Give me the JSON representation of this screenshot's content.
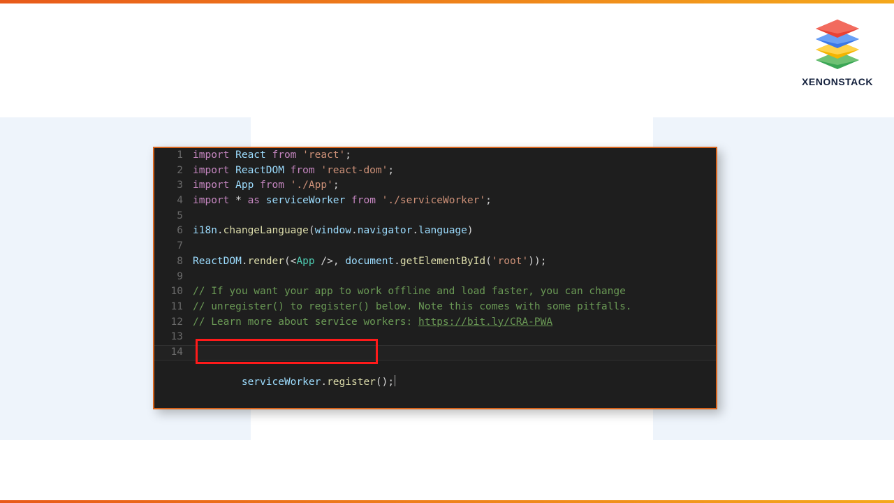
{
  "brand": {
    "name": "XENONSTACK"
  },
  "code": {
    "line_numbers": [
      "1",
      "2",
      "3",
      "4",
      "5",
      "6",
      "7",
      "8",
      "9",
      "10",
      "11",
      "12",
      "13",
      "14"
    ],
    "l1": {
      "import": "import ",
      "sym": "React",
      "from": " from ",
      "str": "'react'",
      "end": ";"
    },
    "l2": {
      "import": "import ",
      "sym": "ReactDOM",
      "from": " from ",
      "str": "'react-dom'",
      "end": ";"
    },
    "l3": {
      "import": "import ",
      "sym": "App",
      "from": " from ",
      "str": "'./App'",
      "end": ";"
    },
    "l4": {
      "import": "import ",
      "star": "* ",
      "as": "as ",
      "sym": "serviceWorker",
      "from": " from ",
      "str": "'./serviceWorker'",
      "end": ";"
    },
    "l6": {
      "a": "i18n",
      "dot1": ".",
      "b": "changeLanguage",
      "open": "(",
      "c": "window",
      "dot2": ".",
      "d": "navigator",
      "dot3": ".",
      "e": "language",
      "close": ")"
    },
    "l8": {
      "a": "ReactDOM",
      "dot": ".",
      "fn": "render",
      "open": "(",
      "lt": "<",
      "tag": "App",
      "sc": " />",
      "comma": ", ",
      "doc": "document",
      "dot2": ".",
      "gebi": "getElementById",
      "p": "(",
      "root": "'root'",
      "p2": ")",
      "close": ");"
    },
    "l10": "// If you want your app to work offline and load faster, you can change",
    "l11": "// unregister() to register() below. Note this comes with some pitfalls.",
    "l12": {
      "pre": "// Learn more about service workers: ",
      "link": "https://bit.ly/CRA-PWA"
    },
    "l14": {
      "a": "serviceWorker",
      "dot": ".",
      "fn": "register",
      "paren": "();"
    }
  }
}
